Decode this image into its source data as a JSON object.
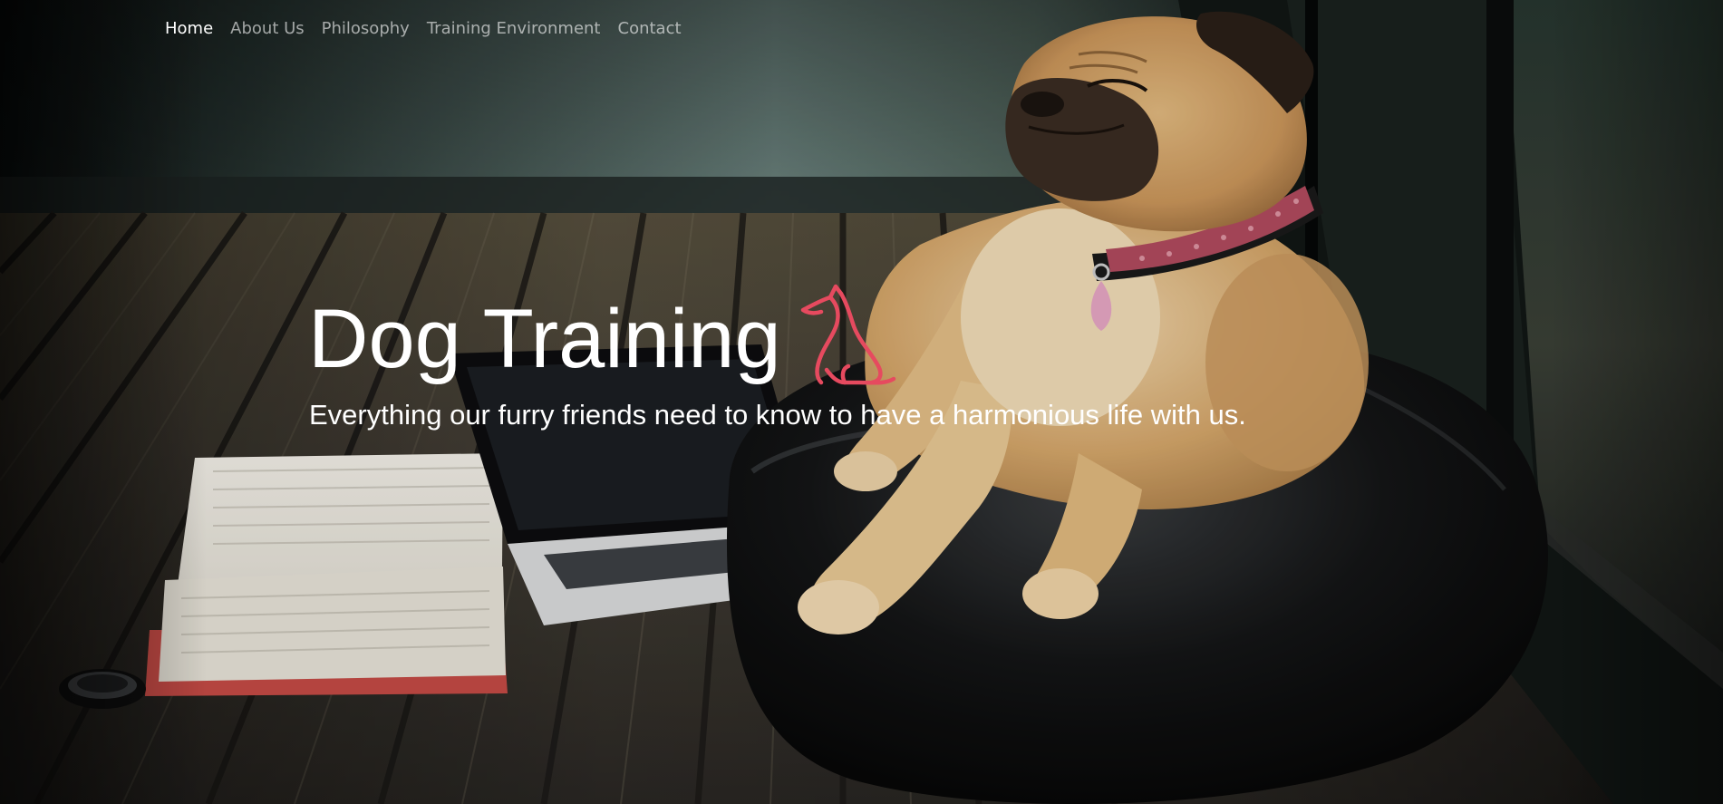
{
  "nav": {
    "items": [
      {
        "label": "Home",
        "active": true
      },
      {
        "label": "About Us",
        "active": false
      },
      {
        "label": "Philosophy",
        "active": false
      },
      {
        "label": "Training Environment",
        "active": false
      },
      {
        "label": "Contact",
        "active": false
      }
    ]
  },
  "hero": {
    "title": "Dog Training",
    "subtitle": "Everything our furry friends need to know to have a harmonious life with us.",
    "logo_icon": "sitting-dog-icon",
    "logo_color": "#e64a5f",
    "background_image": "pug-on-beanbag-photo"
  },
  "colors": {
    "nav_active": "#ffffff",
    "nav_inactive": "rgba(255,255,255,0.6)",
    "text": "#ffffff"
  }
}
